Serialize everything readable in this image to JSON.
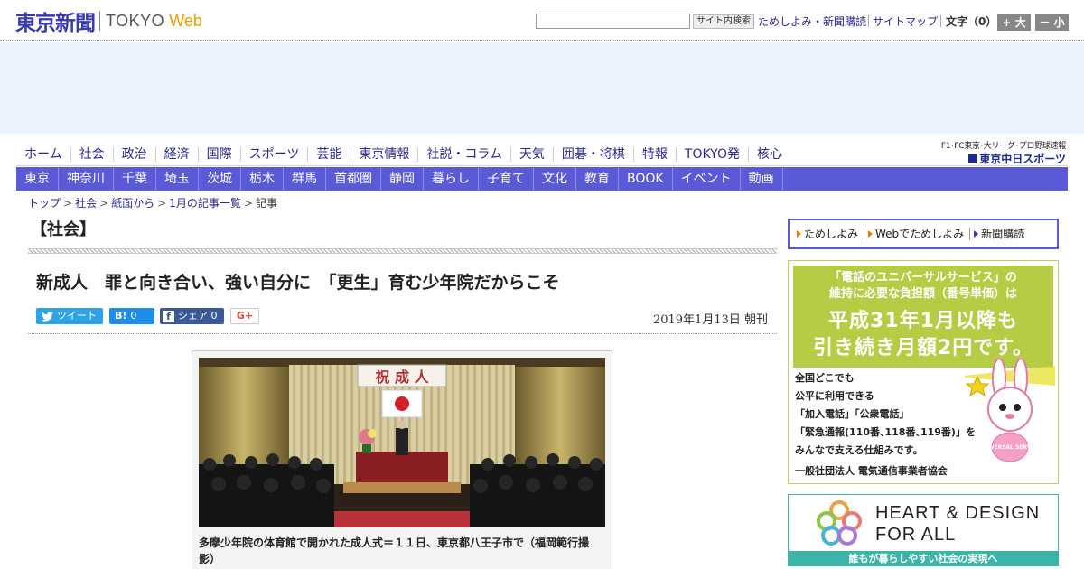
{
  "header": {
    "logo_jp": "東京新聞",
    "logo_tokyo": "TOKYO",
    "logo_web": "Web",
    "search_button": "サイト内検索",
    "links": [
      "ためしよみ・新聞購読",
      "サイトマップ"
    ],
    "font_size_label": "文字（0）",
    "font_plus": "+ 大",
    "font_minus": "－ 小"
  },
  "main_nav": [
    "ホーム",
    "社会",
    "政治",
    "経済",
    "国際",
    "スポーツ",
    "芸能",
    "東京情報",
    "社説・コラム",
    "天気",
    "囲碁・将棋",
    "特報",
    "TOKYO発",
    "核心"
  ],
  "sports": {
    "sub": "F1･FC東京･大リーグ･プロ野球速報",
    "main": "東京中日スポーツ"
  },
  "region_nav": [
    "東京",
    "神奈川",
    "千葉",
    "埼玉",
    "茨城",
    "栃木",
    "群馬",
    "首都圏",
    "静岡",
    "暮らし",
    "子育て",
    "文化",
    "教育",
    "BOOK",
    "イベント",
    "動画"
  ],
  "breadcrumb": [
    "トップ",
    "社会",
    "紙面から",
    "1月の記事一覧",
    "記事"
  ],
  "article": {
    "section": "【社会】",
    "headline": "新成人　罪と向き合い、強い自分に　「更生」育む少年院だからこそ",
    "date": "2019年1月13日 朝刊",
    "photo_banner": "祝 成 人",
    "caption": "多摩少年院の体育館で開かれた成人式＝１１日、東京都八王子市で（福岡範行撮影）"
  },
  "share": {
    "twitter": "ツイート",
    "hatena_icon": "B!",
    "hatena_count": "0",
    "facebook_icon": "f",
    "facebook": "シェア",
    "facebook_count": "0",
    "gplus": "G+"
  },
  "sidebar": {
    "tameshi": [
      "ためしよみ",
      "Webでためしよみ",
      "新聞購読"
    ],
    "ad1": {
      "line1": "「電話のユニバーサルサービス」の",
      "line2": "維持に必要な負担額（番号単価）は",
      "big1": "平成31年1月以降も",
      "big2": "引き続き月額2円です。",
      "body": [
        "全国どこでも",
        "公平に利用できる",
        "「加入電話」「公衆電話」",
        "「緊急通報(110番､118番､119番)」を",
        "みんなで支える仕組みです。"
      ],
      "footer": "一般社団法人 電気通信事業者協会",
      "badge": "UNIVERSAL SERVICE"
    },
    "ad2": {
      "title1": "HEART & DESIGN",
      "title2": "FOR ALL",
      "footer": "誰もが暮らしやすい社会の実現へ"
    }
  },
  "colors": {
    "brand_blue": "#3a3ab0",
    "region_nav": "#5a5ad6",
    "link": "#2a2a8a",
    "ad_green": "#b5cc45",
    "ad_teal": "#3cb4a8"
  }
}
